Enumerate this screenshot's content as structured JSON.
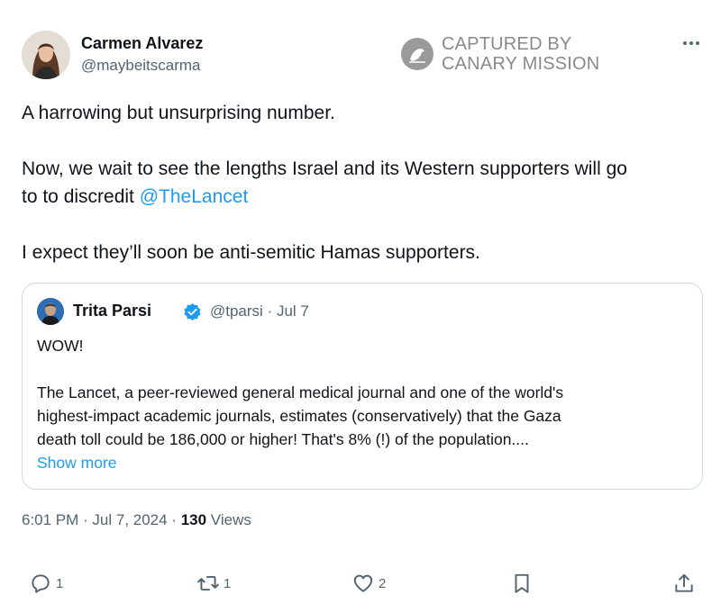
{
  "author": {
    "name": "Carmen Alvarez",
    "handle": "@maybeitscarma"
  },
  "watermark": {
    "line1": "CAPTURED BY",
    "line2": "CANARY MISSION"
  },
  "tweet": {
    "line1": "A harrowing but unsurprising number.",
    "line2": "Now, we wait to see the lengths Israel and its Western supporters will go",
    "line3_prefix": "to to discredit ",
    "mention": "@TheLancet",
    "line4": "I expect they’ll soon be anti-semitic Hamas supporters."
  },
  "quote": {
    "name": "Trita Parsi",
    "handle": "@tparsi",
    "date": "· Jul 7",
    "line1": "WOW!",
    "line2": "The Lancet, a peer-reviewed general medical journal and one of the world's",
    "line3": "highest-impact academic journals, estimates (conservatively) that the Gaza",
    "line4": "death toll could be 186,000 or higher!  That's 8% (!) of the population....",
    "show_more": "Show more"
  },
  "meta": {
    "time": "6:01 PM · Jul 7, 2024 · ",
    "views_count": "130",
    "views_label": " Views"
  },
  "actions": {
    "replies": "1",
    "reposts": "1",
    "likes": "2"
  },
  "colors": {
    "link": "#1d9bf0",
    "secondary_text": "#536471",
    "border": "#cfd9de"
  },
  "icons": [
    "more-icon",
    "verified-badge-icon",
    "reply-icon",
    "repost-icon",
    "like-icon",
    "bookmark-icon",
    "share-icon",
    "canary-logo-icon"
  ]
}
